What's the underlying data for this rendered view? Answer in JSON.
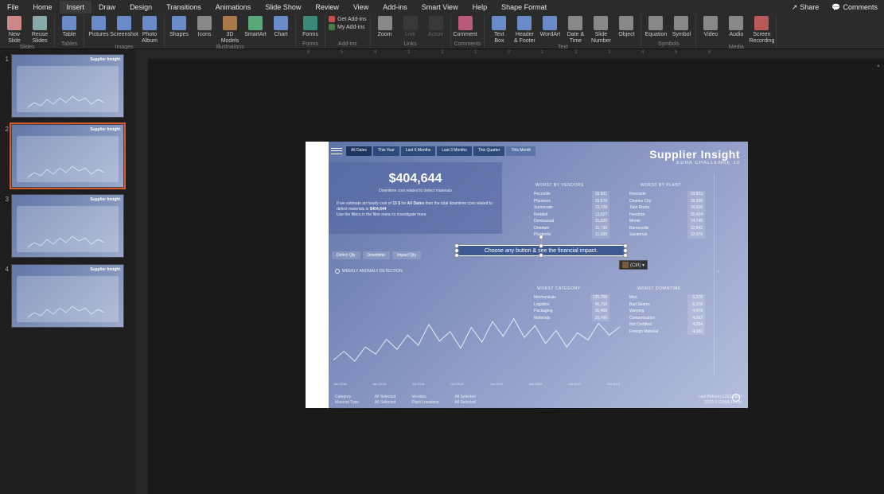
{
  "menu": {
    "items": [
      "File",
      "Home",
      "Insert",
      "Draw",
      "Design",
      "Transitions",
      "Animations",
      "Slide Show",
      "Review",
      "View",
      "Add-ins",
      "Smart View",
      "Help",
      "Shape Format"
    ],
    "active_index": 2,
    "share": "Share",
    "comments": "Comments"
  },
  "ribbon": {
    "groups": [
      {
        "label": "Slides",
        "buttons": [
          {
            "l": "New\nSlide",
            "c": "#c88"
          },
          {
            "l": "Reuse\nSlides",
            "c": "#8aa"
          }
        ]
      },
      {
        "label": "Tables",
        "buttons": [
          {
            "l": "Table",
            "c": "#6a8ac8"
          }
        ]
      },
      {
        "label": "Images",
        "buttons": [
          {
            "l": "Pictures",
            "c": "#6a8ac8"
          },
          {
            "l": "Screenshot",
            "c": "#6a8ac8"
          },
          {
            "l": "Photo\nAlbum",
            "c": "#6a8ac8"
          }
        ]
      },
      {
        "label": "Illustrations",
        "buttons": [
          {
            "l": "Shapes",
            "c": "#6a8ac8"
          },
          {
            "l": "Icons",
            "c": "#888"
          },
          {
            "l": "3D\nModels",
            "c": "#a87a4a"
          },
          {
            "l": "SmartArt",
            "c": "#5aa87a"
          },
          {
            "l": "Chart",
            "c": "#6a8ac8"
          }
        ]
      },
      {
        "label": "Forms",
        "buttons": [
          {
            "l": "Forms",
            "c": "#3a8a7a"
          }
        ]
      },
      {
        "label": "Add-ins",
        "addins": [
          {
            "t": "Get Add-ins"
          },
          {
            "t": "My Add-ins"
          }
        ]
      },
      {
        "label": "Links",
        "buttons": [
          {
            "l": "Zoom",
            "c": "#888"
          },
          {
            "l": "Link",
            "c": "#555",
            "dim": true
          },
          {
            "l": "Action",
            "c": "#555",
            "dim": true
          }
        ]
      },
      {
        "label": "Comments",
        "buttons": [
          {
            "l": "Comment",
            "c": "#b85a7a"
          }
        ]
      },
      {
        "label": "Text",
        "buttons": [
          {
            "l": "Text\nBox",
            "c": "#6a8ac8"
          },
          {
            "l": "Header\n& Footer",
            "c": "#6a8ac8"
          },
          {
            "l": "WordArt",
            "c": "#6a8ac8"
          },
          {
            "l": "Date &\nTime",
            "c": "#888"
          },
          {
            "l": "Slide\nNumber",
            "c": "#888"
          },
          {
            "l": "Object",
            "c": "#888"
          }
        ]
      },
      {
        "label": "Symbols",
        "buttons": [
          {
            "l": "Equation",
            "c": "#888"
          },
          {
            "l": "Symbol",
            "c": "#888"
          }
        ]
      },
      {
        "label": "Media",
        "buttons": [
          {
            "l": "Video",
            "c": "#888"
          },
          {
            "l": "Audio",
            "c": "#888"
          },
          {
            "l": "Screen\nRecording",
            "c": "#b85a5a"
          }
        ]
      }
    ]
  },
  "thumbs": {
    "count": 4,
    "selected": 2,
    "mini_title": "Supplier Insight"
  },
  "ruler_h": [
    "6",
    "5",
    "4",
    "3",
    "2",
    "1",
    "0",
    "1",
    "2",
    "3",
    "4",
    "5",
    "6"
  ],
  "slide": {
    "brand_title": "Supplier Insight",
    "brand_sub": "EDNA CHALLENGE 10",
    "tabs": [
      {
        "l": "All Dates",
        "sel": true
      },
      {
        "l": "This Year"
      },
      {
        "l": "Last 6\nMonths"
      },
      {
        "l": "Last 3\nMonths"
      },
      {
        "l": "This\nQuarter"
      },
      {
        "l": "This Month",
        "lite": true
      }
    ],
    "kpi": "$404,644",
    "kpi_sub": "Downtime cost related to defect materials",
    "note_pre": "If we estimate an hourly cost of ",
    "note_rate": "15 $",
    "note_mid": " for ",
    "note_scope": "All Dates",
    "note_post": " then the total downtime cost related to defect materials is ",
    "note_val": "$404,644",
    "note_line2": "Use the filters in the filter menu to investigate more",
    "mini_tabs": [
      "Defect Qty",
      "Downtime",
      "Impact Qty"
    ],
    "weekly": "WEEKLY ANOMALY DETECTION",
    "sel_text": "Choose any button & see the financial impact.",
    "paste_label": "(Ctrl) ▾",
    "sections": {
      "vendors": {
        "title": "WORST BY VENDORS",
        "rows": [
          [
            "Recontile",
            "16,501"
          ],
          [
            "Plumtone",
            "15,579"
          ],
          [
            "Sunnovate",
            "13,728"
          ],
          [
            "Reddoit",
            "13,027"
          ],
          [
            "Dentowood",
            "11,929"
          ],
          [
            "Ontotam",
            "11,739"
          ],
          [
            "Plustechs",
            "11,565"
          ]
        ]
      },
      "plant": {
        "title": "WORST BY PLANT",
        "rows": [
          [
            "Riverside",
            "19,503"
          ],
          [
            "Charles City",
            "18,298"
          ],
          [
            "Twin Rocks",
            "16,655"
          ],
          [
            "Hendrick",
            "15,424"
          ],
          [
            "Monte",
            "14,746"
          ],
          [
            "Barnesville",
            "12,542"
          ],
          [
            "Savannah",
            "12,379"
          ]
        ]
      },
      "category": {
        "title": "WORST CATEGORY",
        "rows": [
          [
            "Mechanicals",
            "125,758"
          ],
          [
            "Logistics",
            "45,750"
          ],
          [
            "Packaging",
            "36,458"
          ],
          [
            "Materials",
            "20,766"
          ]
        ]
      },
      "downtime": {
        "title": "WORST DOWNTIME",
        "rows": [
          [
            "Misc",
            "5,378"
          ],
          [
            "Bad Seams",
            "5,178"
          ],
          [
            "Warping",
            "4,479"
          ],
          [
            "Contamination",
            "4,392"
          ],
          [
            "Not Certified",
            "4,284"
          ],
          [
            "Foreign Material",
            "4,180"
          ]
        ]
      }
    },
    "chart_months": [
      "Jan 2018",
      "Apr 2018",
      "Jul 2018",
      "Oct 2018",
      "Jan 2019",
      "Apr 2019",
      "Jul 2019",
      "Oct 2019"
    ],
    "footer": {
      "c1": [
        "Category",
        "Material Type"
      ],
      "c1v": [
        "All Selected",
        "All Selected"
      ],
      "c2": [
        "Vendors",
        "Plant Locations"
      ],
      "c2v": [
        "All Selected",
        "All Selected"
      ],
      "c3": [
        "Last Refresh 12/11/2020",
        "2020 © EDNA 10 Ltd"
      ]
    }
  },
  "chart_data": {
    "type": "line",
    "title": "WEEKLY ANOMALY DETECTION",
    "x": [
      "Jan 2018",
      "Apr 2018",
      "Jul 2018",
      "Oct 2018",
      "Jan 2019",
      "Apr 2019",
      "Jul 2019",
      "Oct 2019"
    ],
    "values": [
      30,
      45,
      28,
      52,
      40,
      65,
      48,
      72,
      55,
      90,
      62,
      78,
      50,
      85,
      60,
      95,
      70,
      100,
      68,
      88,
      58,
      80,
      52,
      76,
      64,
      92,
      72,
      86
    ],
    "ylim": [
      0,
      110
    ]
  }
}
